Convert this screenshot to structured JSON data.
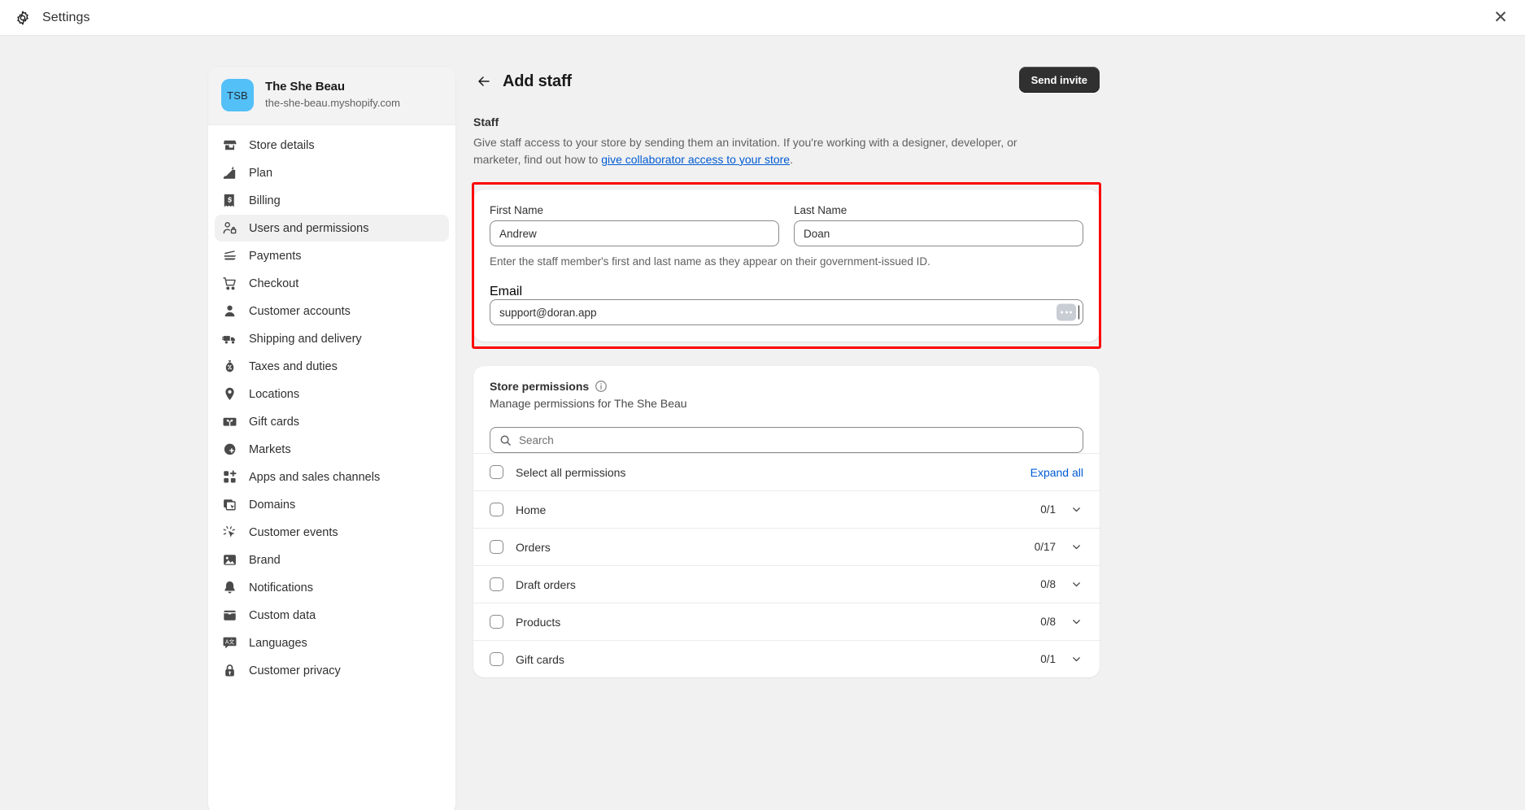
{
  "window": {
    "title": "Settings",
    "gear_icon": "gear-icon",
    "close_icon": "close-icon"
  },
  "sidebar": {
    "store": {
      "initials": "TSB",
      "name": "The She Beau",
      "domain": "the-she-beau.myshopify.com"
    },
    "items": [
      {
        "label": "Store details",
        "icon": "store-icon",
        "active": false
      },
      {
        "label": "Plan",
        "icon": "plan-icon",
        "active": false
      },
      {
        "label": "Billing",
        "icon": "billing-icon",
        "active": false
      },
      {
        "label": "Users and permissions",
        "icon": "users-icon",
        "active": true
      },
      {
        "label": "Payments",
        "icon": "payments-icon",
        "active": false
      },
      {
        "label": "Checkout",
        "icon": "cart-icon",
        "active": false
      },
      {
        "label": "Customer accounts",
        "icon": "person-icon",
        "active": false
      },
      {
        "label": "Shipping and delivery",
        "icon": "truck-icon",
        "active": false
      },
      {
        "label": "Taxes and duties",
        "icon": "tax-icon",
        "active": false
      },
      {
        "label": "Locations",
        "icon": "location-pin-icon",
        "active": false
      },
      {
        "label": "Gift cards",
        "icon": "gift-card-icon",
        "active": false
      },
      {
        "label": "Markets",
        "icon": "globe-icon",
        "active": false
      },
      {
        "label": "Apps and sales channels",
        "icon": "apps-icon",
        "active": false
      },
      {
        "label": "Domains",
        "icon": "domains-icon",
        "active": false
      },
      {
        "label": "Customer events",
        "icon": "customer-events-icon",
        "active": false
      },
      {
        "label": "Brand",
        "icon": "brand-icon",
        "active": false
      },
      {
        "label": "Notifications",
        "icon": "bell-icon",
        "active": false
      },
      {
        "label": "Custom data",
        "icon": "custom-data-icon",
        "active": false
      },
      {
        "label": "Languages",
        "icon": "languages-icon",
        "active": false
      },
      {
        "label": "Customer privacy",
        "icon": "lock-icon",
        "active": false
      }
    ]
  },
  "main": {
    "back_icon": "arrow-left-icon",
    "page_title": "Add staff",
    "send_invite_label": "Send invite",
    "staff": {
      "heading": "Staff",
      "description_before": "Give staff access to your store by sending them an invitation. If you're working with a designer, developer, or marketer, find out how to ",
      "link_text": "give collaborator access to your store",
      "description_after": "."
    },
    "form": {
      "first_name_label": "First Name",
      "first_name_value": "Andrew",
      "first_name_placeholder": "",
      "last_name_label": "Last Name",
      "last_name_value": "Doan",
      "last_name_placeholder": "",
      "name_help": "Enter the staff member's first and last name as they appear on their government-issued ID.",
      "email_label": "Email",
      "email_value": "support@doran.app",
      "email_placeholder": "",
      "autofill_icon": "autofill-dots-icon",
      "highlight_color": "#ff0000"
    },
    "permissions": {
      "title": "Store permissions",
      "info_icon": "info-icon",
      "subtitle": "Manage permissions for The She Beau",
      "search_placeholder": "Search",
      "search_value": "",
      "search_icon": "search-icon",
      "select_all_label": "Select all permissions",
      "expand_all_label": "Expand all",
      "rows": [
        {
          "label": "Home",
          "count": "0/1",
          "chevron": "chevron-down-icon"
        },
        {
          "label": "Orders",
          "count": "0/17",
          "chevron": "chevron-down-icon"
        },
        {
          "label": "Draft orders",
          "count": "0/8",
          "chevron": "chevron-down-icon"
        },
        {
          "label": "Products",
          "count": "0/8",
          "chevron": "chevron-down-icon"
        },
        {
          "label": "Gift cards",
          "count": "0/1",
          "chevron": "chevron-down-icon"
        }
      ]
    }
  }
}
